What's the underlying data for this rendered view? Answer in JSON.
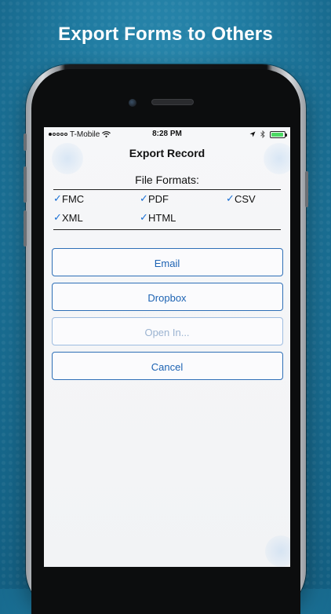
{
  "headline": "Export Forms to Others",
  "status_bar": {
    "carrier": "T-Mobile",
    "time": "8:28 PM",
    "signal_bars_filled": 1,
    "signal_bars_total": 5,
    "battery_level": 0.95
  },
  "screen": {
    "title": "Export Record",
    "formats_label": "File Formats:",
    "formats": [
      {
        "label": "FMC",
        "checked": true
      },
      {
        "label": "PDF",
        "checked": true
      },
      {
        "label": "CSV",
        "checked": true
      },
      {
        "label": "XML",
        "checked": true
      },
      {
        "label": "HTML",
        "checked": true
      }
    ],
    "buttons": {
      "email": "Email",
      "dropbox": "Dropbox",
      "open_in": "Open In...",
      "cancel": "Cancel"
    }
  },
  "colors": {
    "accent": "#1d63b3",
    "check": "#1a6fd4",
    "battery": "#4cd964",
    "background": "#1f7aa0"
  }
}
